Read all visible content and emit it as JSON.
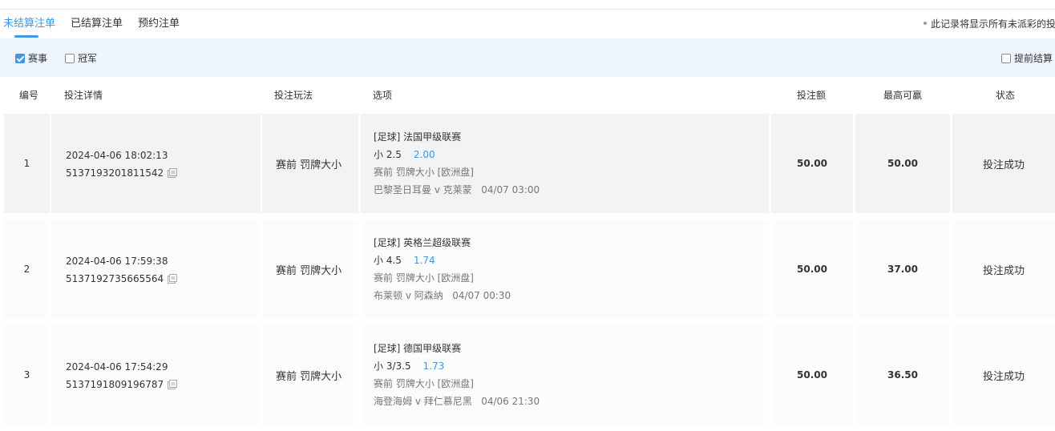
{
  "tabs": [
    {
      "label": "未结算注单",
      "active": true
    },
    {
      "label": "已结算注单",
      "active": false
    },
    {
      "label": "预约注单",
      "active": false
    }
  ],
  "note": "此记录将显示所有未派彩的投",
  "filters": [
    {
      "label": "赛事",
      "checked": true
    },
    {
      "label": "冠军",
      "checked": false
    }
  ],
  "early_settle": {
    "label": "提前结算",
    "checked": false
  },
  "columns": {
    "id": "编号",
    "detail": "投注详情",
    "play": "投注玩法",
    "option": "选项",
    "stake": "投注额",
    "max_win": "最高可赢",
    "status": "状态"
  },
  "rows": [
    {
      "id": "1",
      "time": "2024-04-06 18:02:13",
      "order_no": "5137193201811542",
      "play": "赛前  罚牌大小",
      "league": "[足球] 法国甲级联赛",
      "pick": "小 2.5",
      "odds": "2.00",
      "market": "赛前 罚牌大小 [欧洲盘]",
      "match": "巴黎圣日耳曼 v 克莱蒙",
      "match_time": "04/07 03:00",
      "stake": "50.00",
      "max_win": "50.00",
      "status": "投注成功"
    },
    {
      "id": "2",
      "time": "2024-04-06 17:59:38",
      "order_no": "5137192735665564",
      "play": "赛前  罚牌大小",
      "league": "[足球] 英格兰超级联赛",
      "pick": "小 4.5",
      "odds": "1.74",
      "market": "赛前 罚牌大小 [欧洲盘]",
      "match": "布莱顿 v 阿森纳",
      "match_time": "04/07 00:30",
      "stake": "50.00",
      "max_win": "37.00",
      "status": "投注成功"
    },
    {
      "id": "3",
      "time": "2024-04-06 17:54:29",
      "order_no": "5137191809196787",
      "play": "赛前  罚牌大小",
      "league": "[足球] 德国甲级联赛",
      "pick": "小 3/3.5",
      "odds": "1.73",
      "market": "赛前 罚牌大小 [欧洲盘]",
      "match": "海登海姆 v 拜仁慕尼黑",
      "match_time": "04/06 21:30",
      "stake": "50.00",
      "max_win": "36.50",
      "status": "投注成功"
    }
  ],
  "colors": {
    "accent": "#3a97e9",
    "filter_bg": "#eff5fd",
    "row_odd": "#f2f3f5",
    "row_even": "#fbfcfe"
  }
}
